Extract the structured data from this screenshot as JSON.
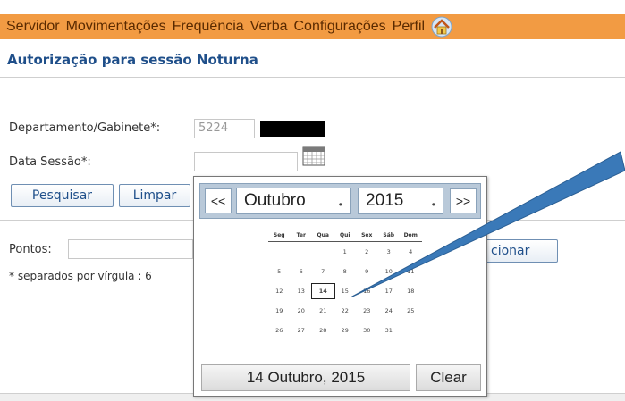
{
  "menu": {
    "items": [
      "Servidor",
      "Movimentações",
      "Frequência",
      "Verba",
      "Configurações",
      "Perfil"
    ],
    "home_icon": "home-icon"
  },
  "page": {
    "title": "Autorização para sessão Noturna"
  },
  "form": {
    "departamento_label": "Departamento/Gabinete*:",
    "departamento_value": "5224",
    "data_sessao_label": "Data Sessão*:",
    "data_sessao_value": "",
    "pesquisar_label": "Pesquisar",
    "limpar_label": "Limpar",
    "pontos_label": "Pontos:",
    "pontos_value": "",
    "pontos_hint": "* separados por vírgula : 6",
    "adicionar_label": "cionar"
  },
  "datepicker": {
    "prev_label": "<<",
    "next_label": ">>",
    "month": "Outubro",
    "year": "2015",
    "weekdays": [
      "Seg",
      "Ter",
      "Qua",
      "Qui",
      "Sex",
      "Sáb",
      "Dom"
    ],
    "weeks": [
      [
        "",
        "",
        "",
        "1",
        "2",
        "3",
        "4"
      ],
      [
        "5",
        "6",
        "7",
        "8",
        "9",
        "10",
        "11"
      ],
      [
        "12",
        "13",
        "14",
        "15",
        "16",
        "17",
        "18"
      ],
      [
        "19",
        "20",
        "21",
        "22",
        "23",
        "24",
        "25"
      ],
      [
        "26",
        "27",
        "28",
        "29",
        "30",
        "31",
        ""
      ]
    ],
    "today": "14",
    "today_label": "14 Outubro, 2015",
    "clear_label": "Clear"
  },
  "colors": {
    "menu_bg": "#f29b43",
    "title": "#1f4f8a",
    "arrow": "#3a79b8"
  }
}
